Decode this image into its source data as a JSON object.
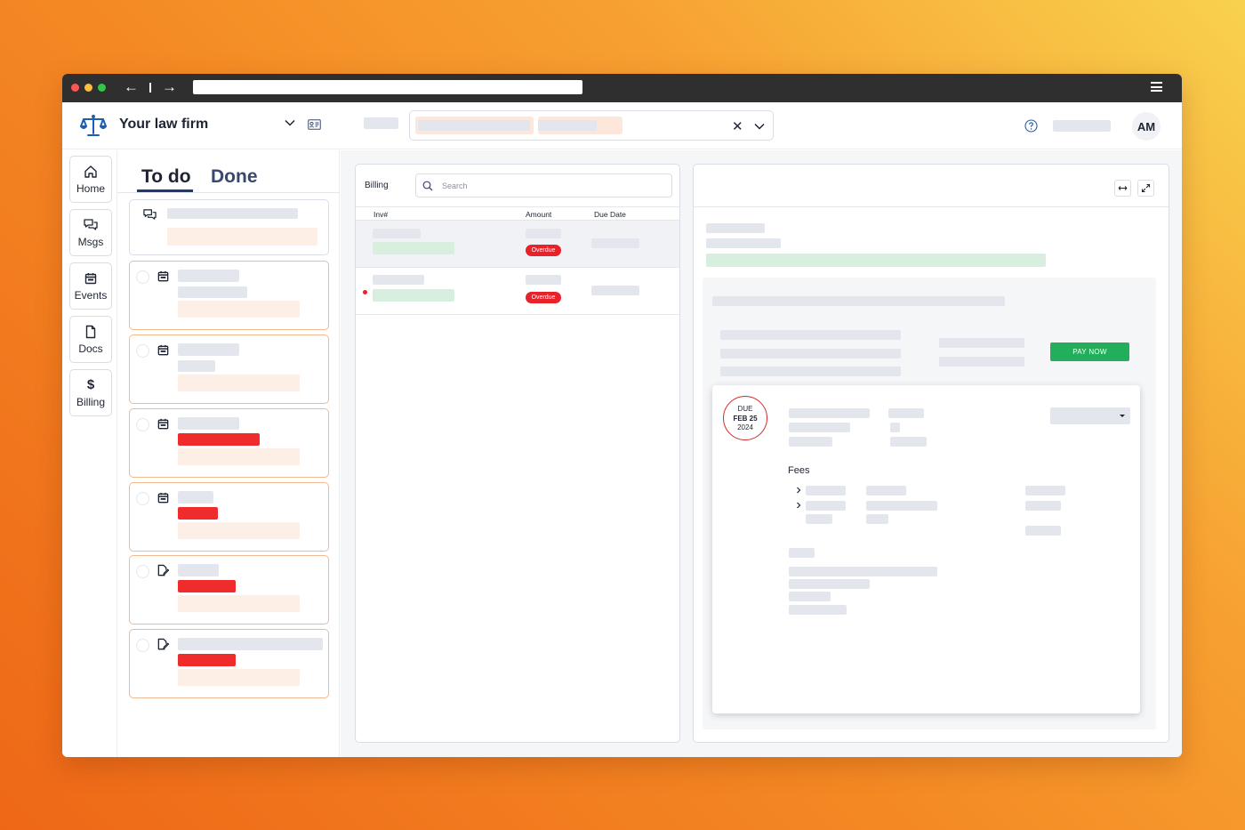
{
  "browser": {
    "traffic_lights": [
      "#fc5753",
      "#fdbc40",
      "#33c748"
    ],
    "back_icon": "arrow-left-icon",
    "forward_icon": "arrow-right-icon",
    "menu_icon": "hamburger-icon"
  },
  "header": {
    "firm_name": "Your law firm",
    "user_initials": "AM",
    "logo_icon": "scales-of-justice-icon",
    "clear_icon": "close-icon",
    "help_icon": "help-circle-icon"
  },
  "nav": {
    "items": [
      {
        "label": "Home",
        "icon": "home-icon"
      },
      {
        "label": "Msgs",
        "icon": "messages-icon"
      },
      {
        "label": "Events",
        "icon": "calendar-icon"
      },
      {
        "label": "Docs",
        "icon": "document-icon"
      },
      {
        "label": "Billing",
        "icon": "dollar-icon",
        "glyph": "$"
      }
    ]
  },
  "todo": {
    "tab_todo": "To do",
    "tab_done": "Done"
  },
  "billing": {
    "title": "Billing",
    "search_placeholder": "Search",
    "columns": [
      "Inv#",
      "Amount",
      "Due Date"
    ],
    "rows": [
      {
        "status": "Overdue"
      },
      {
        "status": "Overdue"
      }
    ]
  },
  "detail": {
    "pay_now": "PAY NOW",
    "due": {
      "line1": "DUE",
      "line2": "FEB 25",
      "line3": "2024"
    },
    "fees_label": "Fees",
    "colors": {
      "accent_red": "#e8222b",
      "pay_green": "#22ae5a",
      "brand_blue": "#1e5fb3"
    }
  }
}
